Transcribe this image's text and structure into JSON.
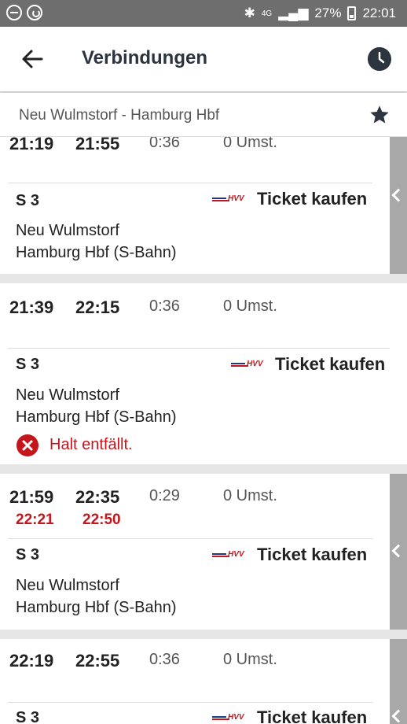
{
  "status_bar": {
    "network": "4G",
    "battery": "27%",
    "time": "22:01"
  },
  "header": {
    "title": "Verbindungen",
    "route": "Neu Wulmstorf - Hamburg Hbf"
  },
  "connections": [
    {
      "dep": "21:19",
      "arr": "21:55",
      "duration": "0:36",
      "changes": "0 Umst.",
      "line": "S 3",
      "ticket": "Ticket kaufen",
      "hvv": "HVV",
      "from": "Neu Wulmstorf",
      "to": "Hamburg Hbf (S-Bahn)"
    },
    {
      "dep": "21:39",
      "arr": "22:15",
      "duration": "0:36",
      "changes": "0 Umst.",
      "line": "S 3",
      "ticket": "Ticket kaufen",
      "hvv": "HVV",
      "from": "Neu Wulmstorf",
      "to": "Hamburg Hbf (S-Bahn)",
      "warning": "Halt entfällt."
    },
    {
      "dep": "21:59",
      "arr": "22:35",
      "dep_delay": "22:21",
      "arr_delay": "22:50",
      "duration": "0:29",
      "changes": "0 Umst.",
      "line": "S 3",
      "ticket": "Ticket kaufen",
      "hvv": "HVV",
      "from": "Neu Wulmstorf",
      "to": "Hamburg Hbf (S-Bahn)"
    },
    {
      "dep": "22:19",
      "arr": "22:55",
      "duration": "0:36",
      "changes": "0 Umst.",
      "line": "S 3",
      "ticket": "Ticket kaufen",
      "hvv": "HVV"
    }
  ],
  "colors": {
    "status_bar": "#6e6e6e",
    "delay_red": "#c4161c",
    "side_tab": "#a8a8a8",
    "title_text": "#2c3440"
  }
}
